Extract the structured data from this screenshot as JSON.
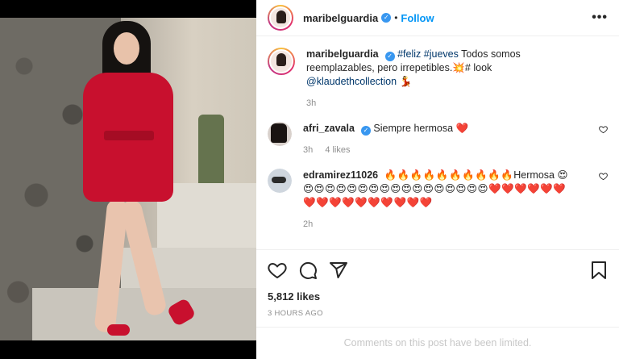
{
  "post": {
    "author": "maribelguardia",
    "follow_label": "Follow",
    "dot": "•",
    "more_label": "•••",
    "verified_glyph": "✓"
  },
  "caption": {
    "username": "maribelguardia",
    "tag1": "#feliz",
    "tag2": "#jueves",
    "text1": "Todos somos reemplazables, pero irrepetibles.💥#",
    "text2": "look",
    "mention": "@klaudethcollection",
    "emoji": "💃",
    "time": "3h"
  },
  "comments": [
    {
      "username": "afri_zavala",
      "text": "Siempre hermosa ❤️",
      "time": "3h",
      "likes": "4 likes"
    },
    {
      "username": "edramirez11026",
      "text_start": "🔥🔥🔥🔥🔥🔥🔥🔥🔥🔥",
      "text_word": "Hermosa",
      "text_end": "😍😍😍😍😍😍😍😍😍😍😍😍😍😍😍😍😍😍❤️❤️❤️❤️❤️❤️❤️❤️❤️❤️❤️❤️❤️❤️❤️❤️",
      "time": "2h"
    }
  ],
  "actions": {
    "likes": "5,812 likes",
    "posted": "3 HOURS AGO"
  },
  "footer": {
    "limited": "Comments on this post have been limited."
  },
  "colors": {
    "link": "#0095f6",
    "verified": "#3897f0",
    "dress": "#c8102e"
  }
}
